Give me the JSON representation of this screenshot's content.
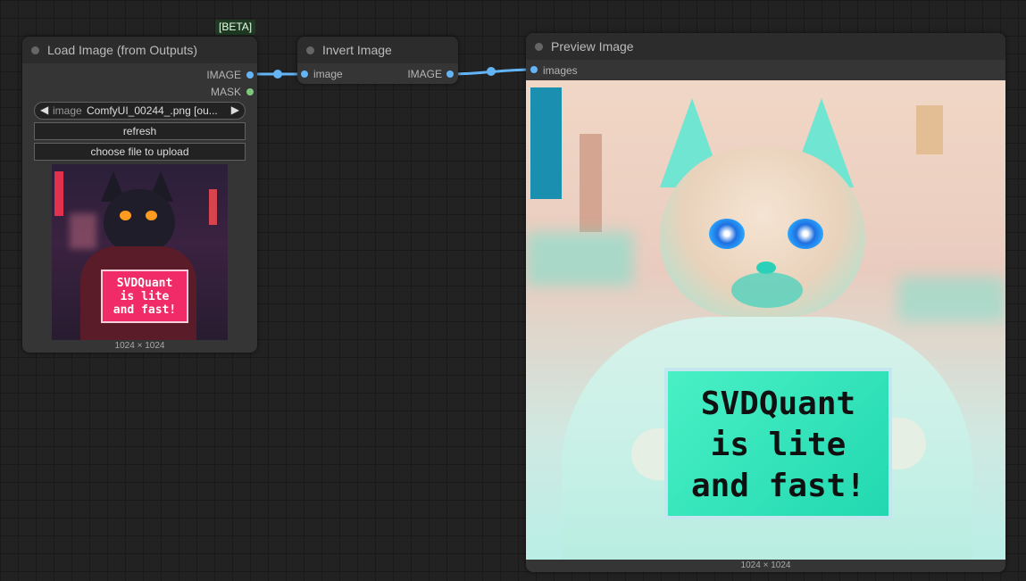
{
  "beta_badge": "[BETA]",
  "load_node": {
    "title": "Load Image (from Outputs)",
    "outputs": [
      "IMAGE",
      "MASK"
    ],
    "image_widget": {
      "name": "image",
      "value": "ComfyUI_00244_.png [ou..."
    },
    "refresh_label": "refresh",
    "upload_label": "choose file to upload",
    "preview_sign": [
      "SVDQuant",
      "is lite",
      "and fast!"
    ],
    "dims": "1024 × 1024"
  },
  "invert_node": {
    "title": "Invert Image",
    "input": "image",
    "output": "IMAGE"
  },
  "preview_node": {
    "title": "Preview Image",
    "input": "images",
    "preview_sign": [
      "SVDQuant",
      "is lite",
      "and fast!"
    ],
    "dims": "1024 × 1024"
  },
  "colors": {
    "link": "#64b5f6",
    "mask_port": "#7ec87e",
    "node_bg": "#353535",
    "canvas_bg": "#222222"
  }
}
